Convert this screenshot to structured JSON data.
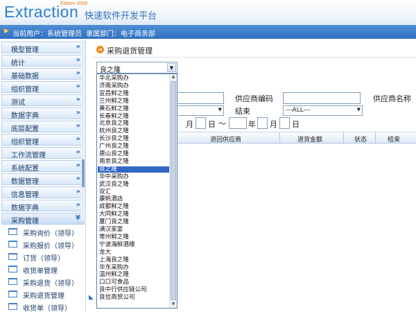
{
  "header": {
    "logo": "Extraction",
    "edition": "Edition 2008",
    "tagline": "快速软件开发平台"
  },
  "userbar": {
    "current_user": "当前用户：系统管理员",
    "department": "隶属部门：电子商务部"
  },
  "sidebar": {
    "menu": [
      "模型管理",
      "统计",
      "基础数据",
      "组织管理",
      "测试",
      "数据字典",
      "底层配置",
      "组织管理",
      "工作流管理",
      "系统配置",
      "数据管理",
      "信息管理",
      "数据字典",
      "采购管理"
    ],
    "chevron": "»",
    "active_chevron": "¥",
    "submenu": [
      "采购询价（领导）",
      "采购报价（领导）",
      "订货（领导）",
      "收货单管理",
      "采购退货（领导）",
      "采购退货管理",
      "收货单（领导）"
    ]
  },
  "main": {
    "title": "采购退货管理",
    "supplier_code_label": "供应商编码",
    "supplier_name_label": "供应商名称",
    "settle_label": "结束",
    "settle_value": "---ALL---",
    "month": "月",
    "day": "日",
    "year": "年",
    "tilde": "～",
    "table_headers": [
      "退回供应商",
      "退货金额",
      "状态",
      "结束"
    ]
  },
  "combo": {
    "value": "良之隆",
    "options": [
      "华北采购办",
      "济南采购办",
      "宜昌鲜之隆",
      "兰州鲜之隆",
      "黄石鲜之隆",
      "长春鲜之隆",
      "北京良之隆",
      "杭州良之隆",
      "长沙良之隆",
      "广州良之隆",
      "唐山良之隆",
      "南京良之隆",
      "良之隆",
      "华中采购办",
      "武汉良之隆",
      "双汇",
      "康帆酒店",
      "成都鲜之隆",
      "大同鲜之隆",
      "厦门良之隆",
      "满汉家宴",
      "常州鲜之隆",
      "宁波海鲜酒楼",
      "龙大",
      "上海良之隆",
      "华东采购办",
      "温州鲜之隆",
      "口口可食品",
      "良中行供应链公司",
      "良信商贸公司"
    ],
    "selected_index": 12
  }
}
